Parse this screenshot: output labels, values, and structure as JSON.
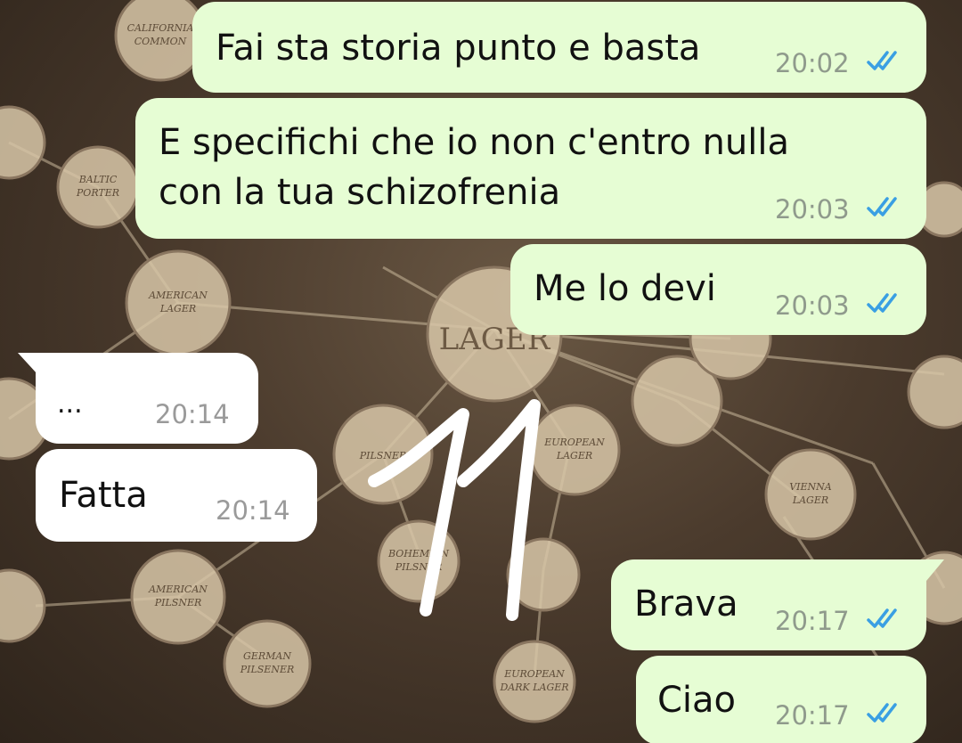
{
  "colors": {
    "outgoing_bubble": "#e6fdd4",
    "incoming_bubble": "#ffffff",
    "read_ticks": "#3a9fe3",
    "wallpaper_tone": "#4b3b2d"
  },
  "wallpaper": {
    "center_label": "LAGER",
    "labels": [
      "AMERICAN LAGER",
      "EUROPEAN LAGER",
      "AMERICAN PILSNER",
      "GERMAN PILSENER",
      "VIENNA LAGER",
      "EUROPEAN DARK LAGER",
      "PILSNER",
      "BOHEMIAN PILSNER",
      "BALTIC PORTER",
      "CALIFORNIA COMMON"
    ],
    "sticker": "11"
  },
  "messages": [
    {
      "text": "Fai sta storia punto e basta",
      "time": "20:02",
      "direction": "out",
      "status_icon": "double-check-read-icon"
    },
    {
      "text": "E specifichi che io non c'entro nulla\ncon la tua schizofrenia",
      "time": "20:03",
      "direction": "out",
      "status_icon": "double-check-read-icon"
    },
    {
      "text": "Me lo devi",
      "time": "20:03",
      "direction": "out",
      "status_icon": "double-check-read-icon"
    },
    {
      "text": "...",
      "time": "20:14",
      "direction": "in"
    },
    {
      "text": "Fatta",
      "time": "20:14",
      "direction": "in"
    },
    {
      "text": "Brava",
      "time": "20:17",
      "direction": "out",
      "status_icon": "double-check-read-icon"
    },
    {
      "text": "Ciao",
      "time": "20:17",
      "direction": "out",
      "status_icon": "double-check-read-icon"
    }
  ]
}
